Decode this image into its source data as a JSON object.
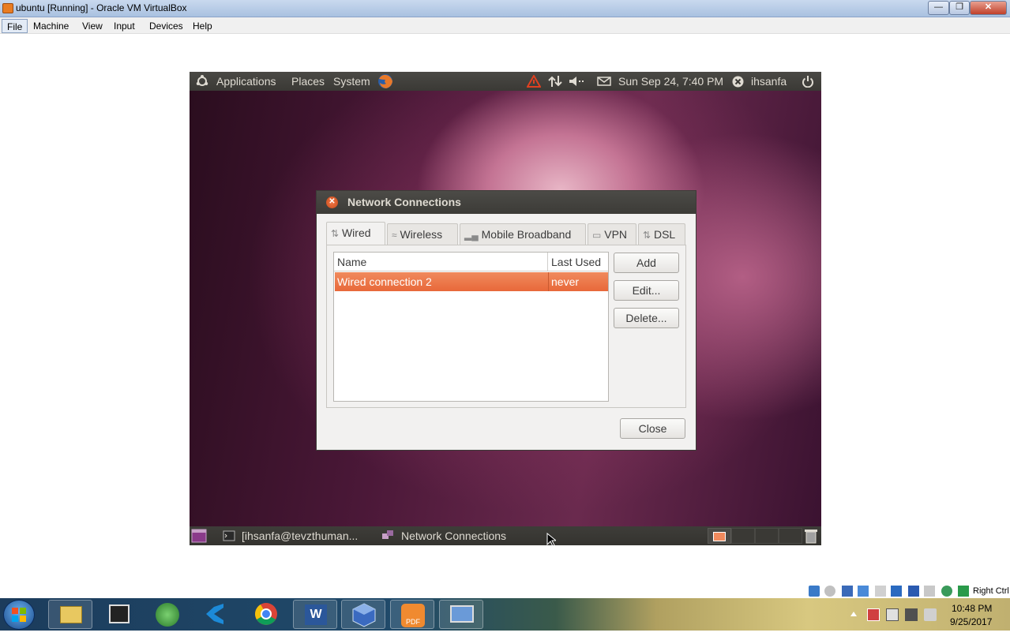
{
  "window": {
    "title": "ubuntu [Running] - Oracle VM VirtualBox"
  },
  "menubar": [
    "File",
    "Machine",
    "View",
    "Input",
    "Devices",
    "Help"
  ],
  "gnome_top": {
    "applications": "Applications",
    "places": "Places",
    "system": "System",
    "clock": "Sun Sep 24,  7:40 PM",
    "user": "ihsanfa"
  },
  "dialog": {
    "title": "Network Connections",
    "tabs": [
      "Wired",
      "Wireless",
      "Mobile Broadband",
      "VPN",
      "DSL"
    ],
    "columns": [
      "Name",
      "Last Used"
    ],
    "rows": [
      {
        "name": "Wired connection 2",
        "last_used": "never"
      }
    ],
    "buttons": {
      "add": "Add",
      "edit": "Edit...",
      "delete": "Delete...",
      "close": "Close"
    }
  },
  "gnome_bottom": {
    "tasks": [
      "[ihsanfa@tevzthuman...",
      "Network Connections"
    ]
  },
  "vbox_status": {
    "host_key": "Right Ctrl"
  },
  "win_taskbar": {
    "time": "10:48 PM",
    "date": "9/25/2017"
  }
}
